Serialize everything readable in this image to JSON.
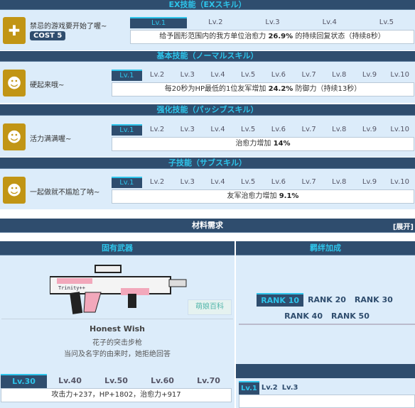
{
  "ex": {
    "header": "EX技能（EXスキル）",
    "name": "禁忌的游戏要开始了喔~",
    "cost": "COST 5",
    "icon": "heal-plus-icon",
    "levels": [
      "Lv.1",
      "Lv.2",
      "Lv.3",
      "Lv.4",
      "Lv.5"
    ],
    "desc_pre": "给予圆形范围内的我方单位治愈力 ",
    "desc_val": "26.9%",
    "desc_post": " 的持续回复状态（持续8秒）"
  },
  "basic": {
    "header": "基本技能（ノーマルスキル）",
    "name": "硬起来哦~",
    "icon": "buff-up-icon",
    "levels": [
      "Lv.1",
      "Lv.2",
      "Lv.3",
      "Lv.4",
      "Lv.5",
      "Lv.6",
      "Lv.7",
      "Lv.8",
      "Lv.9",
      "Lv.10"
    ],
    "desc_pre": "每20秒为HP最低的1位友军增加 ",
    "desc_val": "24.2%",
    "desc_post": " 防御力（持续13秒）"
  },
  "passive": {
    "header": "强化技能（パッシブスキル）",
    "name": "活力满满喔~",
    "icon": "buff-up-icon",
    "levels": [
      "Lv.1",
      "Lv.2",
      "Lv.3",
      "Lv.4",
      "Lv.5",
      "Lv.6",
      "Lv.7",
      "Lv.8",
      "Lv.9",
      "Lv.10"
    ],
    "desc_pre": "治愈力增加 ",
    "desc_val": "14%",
    "desc_post": ""
  },
  "sub": {
    "header": "子技能（サブスキル）",
    "name": "一起做就不尴尬了呐~",
    "icon": "buff-up-icon",
    "levels": [
      "Lv.1",
      "Lv.2",
      "Lv.3",
      "Lv.4",
      "Lv.5",
      "Lv.6",
      "Lv.7",
      "Lv.8",
      "Lv.9",
      "Lv.10"
    ],
    "desc_pre": "友军治愈力增加 ",
    "desc_val": "9.1%",
    "desc_post": ""
  },
  "materials": {
    "header": "材料需求",
    "expand": "[展开]"
  },
  "weapon": {
    "header": "固有武器",
    "name": "Honest Wish",
    "type": "花子的突击步枪",
    "quote": "当问及名字的由来时，她拒绝回答",
    "levels": [
      "Lv.30",
      "Lv.40",
      "Lv.50",
      "Lv.60",
      "Lv.70"
    ],
    "stats": "攻击力+237，HP+1802，治愈力+917",
    "watermark": "萌娘百科"
  },
  "bond": {
    "header": "羁绊加成",
    "ranks": [
      "RANK 10",
      "RANK 20",
      "RANK 30",
      "RANK 40",
      "RANK 50"
    ],
    "levels": [
      "Lv.1",
      "Lv.2",
      "Lv.3"
    ]
  },
  "colors": {
    "header_bg": "#2f4d6e",
    "header_text": "#2ec4ea",
    "section_bg": "#dcecfa",
    "icon_bg": "#c19515"
  }
}
